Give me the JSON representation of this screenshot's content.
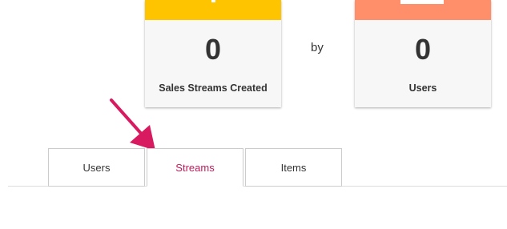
{
  "stats": [
    {
      "value": "0",
      "label": "Sales Streams Created",
      "color": "#ffc400"
    },
    {
      "value": "0",
      "label": "Users",
      "color": "#ff8f6b"
    }
  ],
  "connector": "by",
  "tabs": [
    {
      "label": "Users",
      "active": false
    },
    {
      "label": "Streams",
      "active": true
    },
    {
      "label": "Items",
      "active": false
    }
  ],
  "colors": {
    "active_tab": "#c2185b",
    "arrow": "#d81b60"
  },
  "annotation": {
    "icon": "pointer-arrow-icon"
  }
}
